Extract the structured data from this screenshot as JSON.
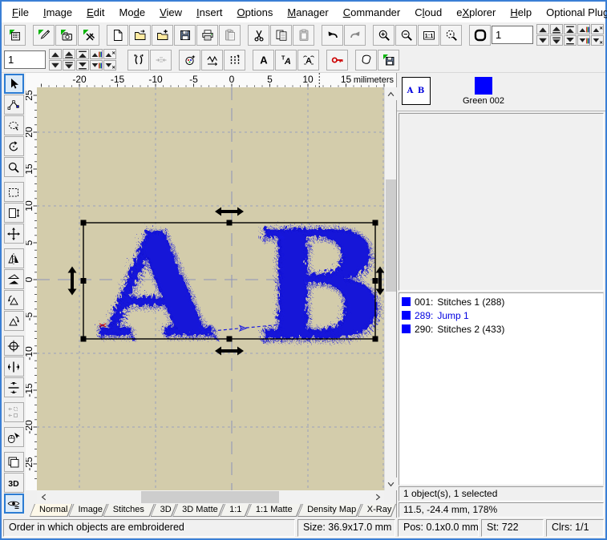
{
  "menu": {
    "items": [
      {
        "label": "File",
        "u": 0
      },
      {
        "label": "Image",
        "u": 0
      },
      {
        "label": "Edit",
        "u": 0
      },
      {
        "label": "Mode",
        "u": 2
      },
      {
        "label": "View",
        "u": 0
      },
      {
        "label": "Insert",
        "u": 0
      },
      {
        "label": "Options",
        "u": 0
      },
      {
        "label": "Manager",
        "u": 0
      },
      {
        "label": "Commander",
        "u": 0
      },
      {
        "label": "Cloud",
        "u": 1
      },
      {
        "label": "eXplorer",
        "u": 1
      },
      {
        "label": "Help",
        "u": 0
      },
      {
        "label": "Optional Plug-ins",
        "u": -1
      }
    ]
  },
  "toolbars": {
    "order_value": "1",
    "stitch_value": "1",
    "main_items": [
      "embird-manager",
      "|",
      "embird-editor",
      "embird-digitizer",
      "erase-stitches",
      "|",
      "new-file",
      "open-file",
      "merge-file",
      "save-file",
      "print",
      {
        "icon": "paste-picture",
        "disabled": true
      },
      "|",
      "cut",
      "copy",
      {
        "icon": "paste",
        "disabled": true
      },
      "|",
      "undo",
      {
        "icon": "redo",
        "disabled": true
      },
      "|",
      "zoom-in",
      "zoom-out",
      "zoom-1-1",
      "zoom-selection",
      "|",
      "hoop"
    ],
    "stitch_items": [
      "separate-objects",
      {
        "icon": "join-objects",
        "disabled": true
      },
      "|",
      "thread-colors",
      "stitch-length",
      "stitch-density",
      "|",
      "lettering",
      "text-edit",
      "monogram",
      "|",
      "password-key",
      "|",
      "freehand-shape",
      "save-colors"
    ],
    "spinners": [
      "move-up",
      "move-up-layer",
      "move-to-front",
      "move-up-color",
      "move-up-object",
      "move-down",
      "move-down-layer",
      "move-to-back",
      "move-down-color",
      "move-down-object"
    ]
  },
  "left_tools": {
    "items": [
      {
        "icon": "select-arrow",
        "active": true
      },
      {
        "icon": "edit-nodes"
      },
      {
        "icon": "freehand-select"
      },
      {
        "icon": "rotate"
      },
      {
        "icon": "zoom"
      },
      {
        "icon": "marquee-select",
        "group": true
      },
      {
        "icon": "resize"
      },
      {
        "icon": "move"
      },
      {
        "icon": "mirror-horizontal",
        "group": true
      },
      {
        "icon": "skew-horizontal"
      },
      {
        "icon": "rotate-ccw-90"
      },
      {
        "icon": "rotate-cw-90"
      },
      {
        "icon": "center-in-hoop",
        "group": true
      },
      {
        "icon": "center-horizontal"
      },
      {
        "icon": "center-vertical"
      },
      {
        "icon": "align-objects",
        "group": true,
        "disabled": true
      },
      {
        "icon": "mouse-functions",
        "group": true
      },
      {
        "icon": "window-frame",
        "group": true
      },
      {
        "icon": "view-3d"
      },
      {
        "icon": "redraw",
        "active": true
      }
    ]
  },
  "ruler": {
    "unit": "milimeters",
    "h_labels": [
      "-20",
      "-15",
      "-10",
      "-5",
      "0",
      "5",
      "10",
      "15"
    ],
    "v_labels": [
      "25",
      "20",
      "15",
      "10",
      "5",
      "0",
      "-5",
      "-10",
      "-15",
      "-20",
      "-25"
    ],
    "cursor_mm": 11.5
  },
  "canvas": {
    "letters": [
      "A",
      "B"
    ],
    "thread_color": "#1717d8",
    "background": "#d3ccab"
  },
  "palette": {
    "thumbnail": "A B",
    "label": "Green 002",
    "color": "#0000ff"
  },
  "object_list": {
    "items": [
      {
        "id": "001:",
        "label": "Stitches 1 (288)",
        "color": "#0000ff",
        "jump": false
      },
      {
        "id": "289:",
        "label": "Jump 1",
        "color": "#0000ff",
        "jump": true
      },
      {
        "id": "290:",
        "label": "Stitches 2 (433)",
        "color": "#0000ff",
        "jump": false
      }
    ]
  },
  "selection_info": {
    "objects": "1 object(s), 1 selected",
    "cursor": "11.5, -24.4 mm, 178%"
  },
  "view_tabs": {
    "selected": 0,
    "items": [
      "Normal",
      "Image",
      "Stitches",
      "3D",
      "3D Matte",
      "1:1",
      "1:1 Matte",
      "Density Map",
      "X-Ray"
    ]
  },
  "status_bar": {
    "message": "Order in which objects are embroidered",
    "size": "Size: 36.9x17.0 mm",
    "pos": "Pos: 0.1x0.0 mm",
    "stitches": "St: 722",
    "colors": "Clrs: 1/1"
  }
}
